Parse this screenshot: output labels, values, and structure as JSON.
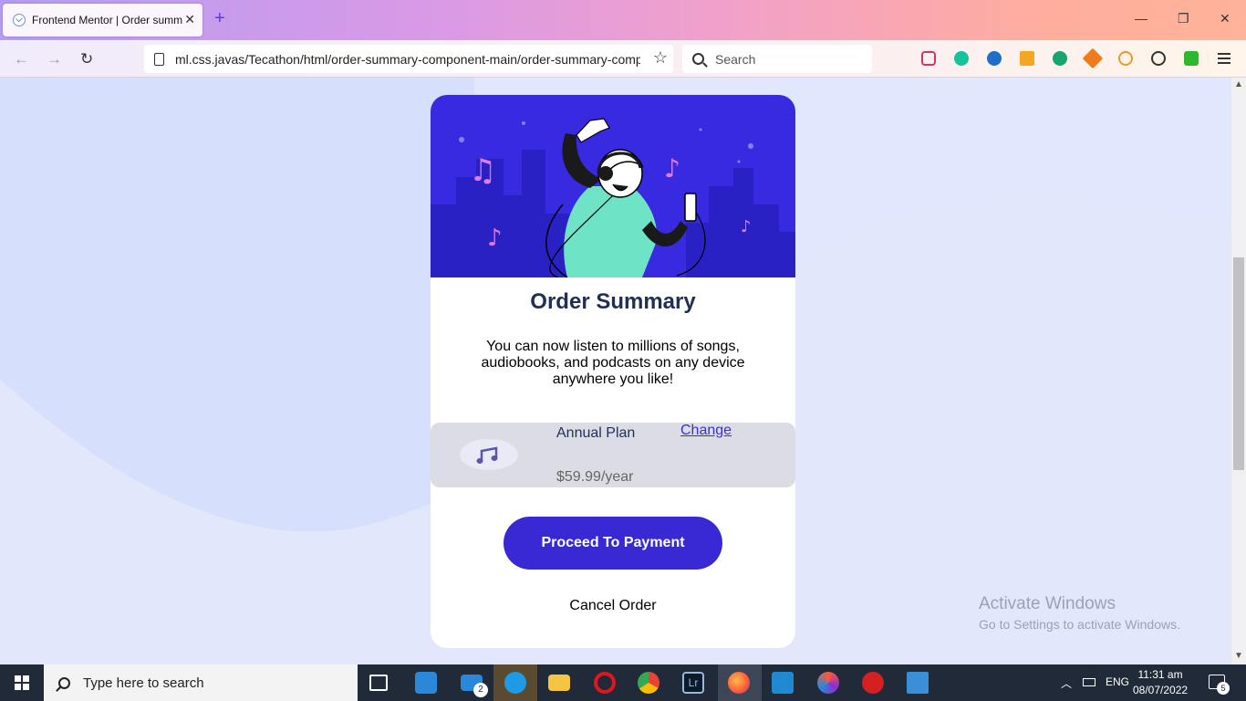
{
  "browser": {
    "tab_title": "Frontend Mentor | Order summ",
    "url": "ml.css.javas/Tecathon/html/order-summary-component-main/order-summary-comp",
    "search_placeholder": "Search"
  },
  "card": {
    "title": "Order Summary",
    "description": "You can now listen to millions of songs, audiobooks, and podcasts on any device anywhere you like!",
    "plan_name": "Annual Plan",
    "plan_price": "$59.99/year",
    "change_link": "Change",
    "pay_button": "Proceed To Payment",
    "cancel_button": "Cancel Order"
  },
  "watermark": {
    "line1": "Activate Windows",
    "line2": "Go to Settings to activate Windows."
  },
  "taskbar": {
    "search_text": "Type here to search",
    "mail_badge": "2",
    "language": "ENG",
    "time": "11:31 am",
    "date": "08/07/2022",
    "notification_count": "5"
  },
  "colors": {
    "primary": "#3829d5",
    "background": "#e1e8fd",
    "heading": "#1f2f56"
  }
}
